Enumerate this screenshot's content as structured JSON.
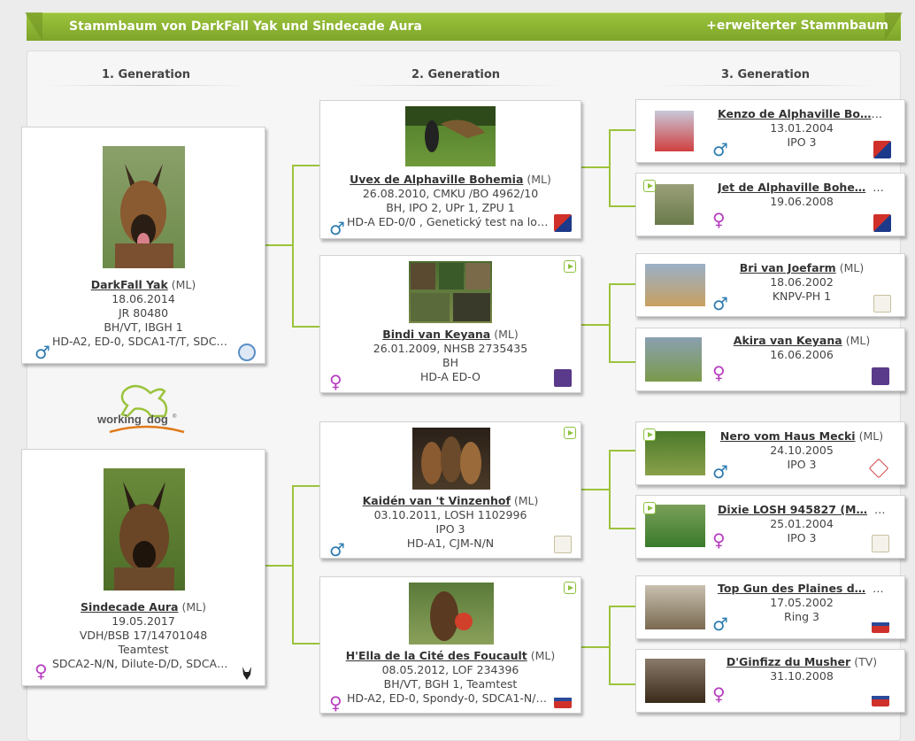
{
  "header": {
    "title": "Stammbaum von DarkFall Yak und Sindecade Aura",
    "extended_link": "+erweiterter Stammbaum"
  },
  "generations": [
    "1. Generation",
    "2. Generation",
    "3. Generation"
  ],
  "logo": {
    "text_a": "working",
    "text_b": "dog",
    "mark": "®"
  },
  "gen1": [
    {
      "name": "DarkFall Yak",
      "breed": "(ML)",
      "lines": [
        "18.06.2014",
        "JR 80480",
        "BH/VT, IBGH 1",
        "HD-A2, ED-0, SDCA1-T/T, SDCA…"
      ],
      "sex": "♂"
    },
    {
      "name": "Sindecade Aura",
      "breed": "(ML)",
      "lines": [
        "19.05.2017",
        "VDH/BSB 17/14701048",
        "Teamtest",
        "SDCA2-N/N, Dilute-D/D, SDCA1…"
      ],
      "sex": "♀"
    }
  ],
  "gen2": [
    {
      "name": "Uvex de Alphaville Bohemia",
      "breed": "(ML)",
      "lines": [
        "26.08.2010, CMKU /BO 4962/10",
        "BH, IPO 2, UPr 1, ZPU 1",
        "HD-A ED-0/0 , Genetický test na loku…"
      ],
      "sex": "♂"
    },
    {
      "name": "Bindi van Keyana",
      "breed": "(ML)",
      "lines": [
        "26.01.2009, NHSB 2735435",
        "BH",
        "HD-A ED-O"
      ],
      "sex": "♀"
    },
    {
      "name": "Kaidén van 't Vinzenhof",
      "breed": "(ML)",
      "lines": [
        "03.10.2011, LOSH 1102996",
        "IPO 3",
        "HD-A1, CJM-N/N"
      ],
      "sex": "♂"
    },
    {
      "name": "H'Ella de la Cité des Foucault",
      "breed": "(ML)",
      "lines": [
        "08.05.2012, LOF 234396",
        "BH/VT, BGH 1, Teamtest",
        "HD-A2, ED-0, Spondy-0, SDCA1-N/N,…"
      ],
      "sex": "♀"
    }
  ],
  "gen3": [
    {
      "name": "Kenzo de Alphaville Bo…",
      "breed": "(ML)",
      "lines": [
        "13.01.2004",
        "IPO 3"
      ],
      "sex": "♂"
    },
    {
      "name": "Jet de Alphaville Bohe…",
      "breed": "(ML)",
      "lines": [
        "19.06.2008"
      ],
      "sex": "♀"
    },
    {
      "name": "Bri van Joefarm",
      "breed": "(ML)",
      "lines": [
        "18.06.2002",
        "KNPV-PH 1"
      ],
      "sex": "♂"
    },
    {
      "name": "Akira van Keyana",
      "breed": "(ML)",
      "lines": [
        "16.06.2006"
      ],
      "sex": "♀"
    },
    {
      "name": "Nero vom Haus Mecki",
      "breed": "(ML)",
      "lines": [
        "24.10.2005",
        "IPO 3"
      ],
      "sex": "♂"
    },
    {
      "name": "Dixie LOSH 945827 (M…",
      "breed": "(ML)",
      "lines": [
        "25.01.2004",
        "IPO 3"
      ],
      "sex": "♀"
    },
    {
      "name": "Top Gun des Plaines d…",
      "breed": "(ML)",
      "lines": [
        "17.05.2002",
        "Ring 3"
      ],
      "sex": "♂"
    },
    {
      "name": "D'Ginfizz du Musher",
      "breed": "(TV)",
      "lines": [
        "31.10.2008"
      ],
      "sex": "♀"
    }
  ]
}
